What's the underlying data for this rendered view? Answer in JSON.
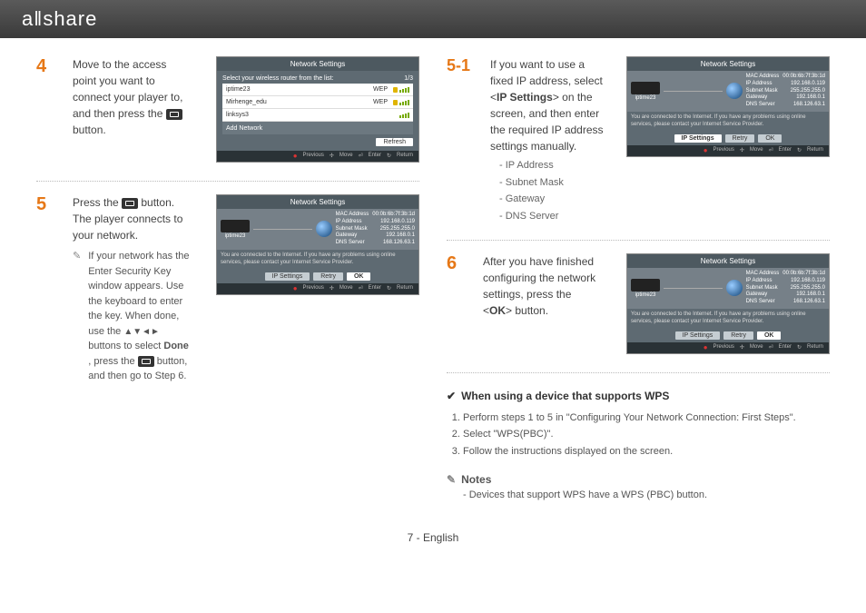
{
  "brand": "aǁshare",
  "steps": {
    "s4": {
      "num": "4",
      "text_a": "Move to the access point you want to connect your player to, and then press the ",
      "text_b": " button."
    },
    "s5": {
      "num": "5",
      "text_a": "Press the ",
      "text_b": " button. The player connects to your network.",
      "note_a": "If your network has the Enter Security Key window appears. Use the keyboard to enter the key. When done, use the ",
      "note_arrows": "▲▼◄►",
      "note_b": "buttons to select ",
      "note_done": "Done",
      "note_c": ", press the ",
      "note_d": " button, and then go to Step 6."
    },
    "s51": {
      "num": "5-1",
      "text_a": "If you want to use a fixed IP address, select <",
      "ip": "IP Settings",
      "text_b": "> on the screen, and then enter the required IP address settings manually.",
      "items": [
        "IP Address",
        "Subnet Mask",
        "Gateway",
        "DNS Server"
      ]
    },
    "s6": {
      "num": "6",
      "text_a": "After you have finished configuring the network settings, press the <",
      "ok": "OK",
      "text_b": "> button."
    }
  },
  "shot": {
    "title": "Network Settings",
    "list_head": "Select your wireless router from the list:",
    "list_page": "1/3",
    "rows": [
      {
        "name": "iptime23",
        "sec": "WEP"
      },
      {
        "name": "Mirhenge_edu",
        "sec": "WEP"
      },
      {
        "name": "linksys3",
        "sec": ""
      },
      {
        "name": "Add Network",
        "sec": ""
      }
    ],
    "refresh": "Refresh",
    "conn_name": "iptime23",
    "conn_msg": "You are connected to the Internet. If you have any problems using online services, please contact your Internet Service Provider.",
    "info": {
      "mac": {
        "k": "MAC Address",
        "v": "00:0b:6b:7f:3b:1d"
      },
      "ip": {
        "k": "IP Address",
        "v": "192.168.0.119"
      },
      "sub": {
        "k": "Subnet Mask",
        "v": "255.255.255.0"
      },
      "gw": {
        "k": "Gateway",
        "v": "192.168.0.1"
      },
      "dns": {
        "k": "DNS Server",
        "v": "168.126.63.1"
      }
    },
    "btns": {
      "ip": "IP Settings",
      "retry": "Retry",
      "ok": "OK"
    },
    "foot": {
      "prev": "Previous",
      "move": "Move",
      "enter": "Enter",
      "ret": "Return"
    }
  },
  "wps": {
    "head": "When using a device that supports WPS",
    "items": [
      "Perform steps 1 to 5 in \"Configuring Your Network Connection: First Steps\".",
      "Select \"WPS(PBC)\".",
      "Follow the instructions displayed on the screen."
    ]
  },
  "notes": {
    "head": "Notes",
    "body": "Devices that support WPS have a WPS (PBC) button."
  },
  "footer": "7 - English"
}
